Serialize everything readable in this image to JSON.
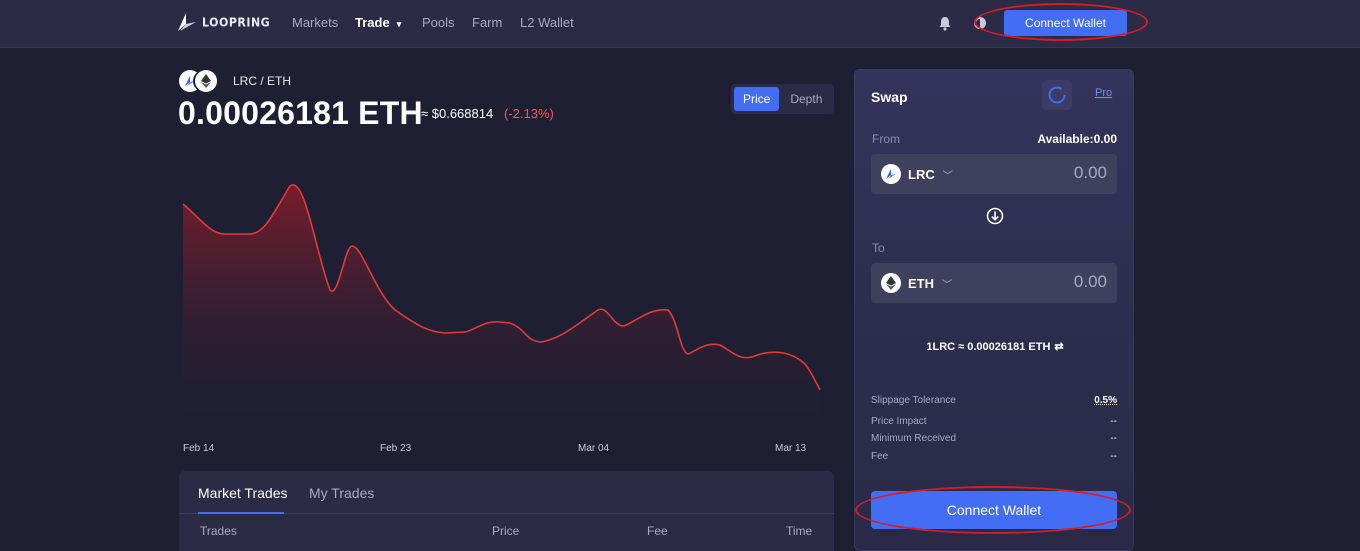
{
  "nav": {
    "logo_text": "LOOPRING",
    "items": [
      {
        "label": "Markets"
      },
      {
        "label": "Trade",
        "active": true
      },
      {
        "label": "Pools"
      },
      {
        "label": "Farm"
      },
      {
        "label": "L2 Wallet"
      }
    ],
    "connect_label": "Connect Wallet",
    "icons": [
      "bell-icon",
      "theme-toggle-icon"
    ]
  },
  "pair": {
    "name": "LRC / ETH",
    "price": "0.00026181 ETH",
    "usd": "≈ $0.668814",
    "change": "(-2.13%)"
  },
  "chart_toggle": {
    "price_label": "Price",
    "depth_label": "Depth",
    "selected": "Price"
  },
  "chart_data": {
    "type": "area",
    "x_labels": [
      "Feb 14",
      "Feb 23",
      "Mar 04",
      "Mar 13"
    ]
  },
  "trades": {
    "tabs": [
      {
        "label": "Market Trades",
        "active": true
      },
      {
        "label": "My Trades"
      }
    ],
    "columns": [
      "Trades",
      "Price",
      "Fee",
      "Time"
    ]
  },
  "swap": {
    "title": "Swap",
    "pro_label": "Pro",
    "from_label": "From",
    "available": "Available:0.00",
    "from_token": "LRC",
    "from_amount": "0.00",
    "to_label": "To",
    "to_token": "ETH",
    "to_amount": "0.00",
    "rate": "1LRC ≈ 0.00026181 ETH",
    "info": [
      {
        "label": "Slippage Tolerance",
        "value": "0.5%"
      },
      {
        "label": "Price Impact",
        "value": "--"
      },
      {
        "label": "Minimum Received",
        "value": "--"
      },
      {
        "label": "Fee",
        "value": "--"
      }
    ],
    "connect_label": "Connect Wallet"
  },
  "colors": {
    "accent": "#446df6",
    "negative": "#f15b5b",
    "highlight": "#d21e24",
    "line": "#e23a3a"
  }
}
